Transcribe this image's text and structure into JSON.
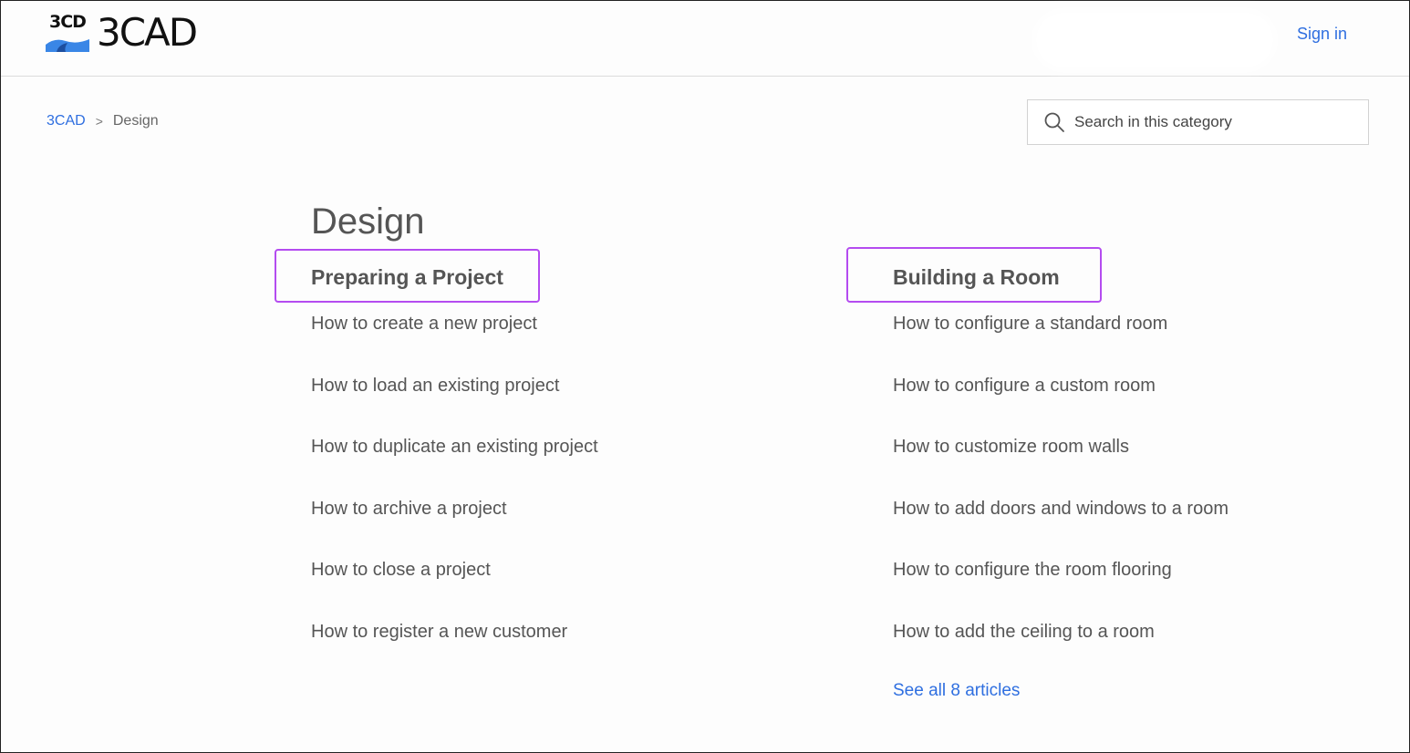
{
  "header": {
    "logo_mark": "3CD",
    "logo_word": "3CAD",
    "sign_in_label": "Sign in"
  },
  "breadcrumb": {
    "root": "3CAD",
    "separator": ">",
    "current": "Design"
  },
  "search": {
    "placeholder": "Search in this category"
  },
  "page": {
    "title": "Design"
  },
  "sections": [
    {
      "title": "Preparing a Project",
      "articles": [
        "How to create a new project",
        "How to load an existing project",
        "How to duplicate an existing project",
        "How to archive a project",
        "How to close a project",
        "How to register a new customer"
      ]
    },
    {
      "title": "Building a Room",
      "articles": [
        "How to configure a standard room",
        "How to configure a custom room",
        "How to customize room walls",
        "How to add doors and windows to a room",
        "How to configure the room flooring",
        "How to add the ceiling to a room"
      ],
      "see_all": "See all 8 articles"
    }
  ],
  "colors": {
    "link": "#2f6fe0",
    "highlight_border": "#b44cf0",
    "text": "#555555",
    "logo_blue": "#3a86e6"
  },
  "icons": {
    "search": "search-icon",
    "logo": "logo-icon"
  }
}
